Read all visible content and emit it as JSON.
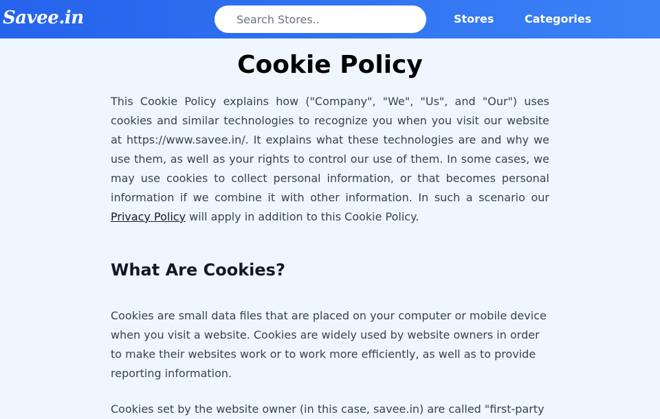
{
  "header": {
    "logo": "Savee.in",
    "search_placeholder": "Search Stores..",
    "search_value": "",
    "nav": {
      "stores": "Stores",
      "categories": "Categories"
    }
  },
  "main": {
    "title": "Cookie Policy",
    "intro": {
      "before_link": "This Cookie Policy explains how (\"Company\", \"We\", \"Us\", and \"Our\") uses cookies and similar technologies to recognize you when you visit our website at https://www.savee.in/. It explains what these technologies are and why we use them, as well as your rights to control our use of them. In some cases, we may use cookies to collect personal information, or that becomes personal information if we combine it with other information. In such a scenario our ",
      "link_text": "Privacy Policy",
      "after_link": " will apply in addition to this Cookie Policy."
    },
    "section": {
      "heading": "What Are Cookies?",
      "paragraphs": [
        "Cookies are small data files that are placed on your computer or mobile device when you visit a website. Cookies are widely used by website owners in order to make their websites work or to work more efficiently, as well as to provide reporting information.",
        "Cookies set by the website owner (in this case, savee.in) are called \"first-party"
      ]
    }
  },
  "colors": {
    "header_start": "#2563eb",
    "header_end": "#3b82f6",
    "page_background": "#eff6ff",
    "body_text": "#374151",
    "heading_text": "#111827"
  }
}
